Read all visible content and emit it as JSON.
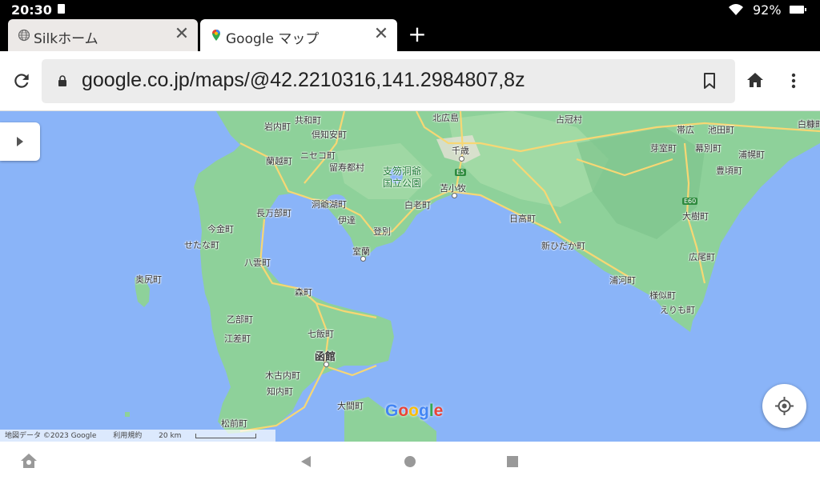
{
  "status": {
    "time": "20:30",
    "battery": "92%"
  },
  "tabs": [
    {
      "label": "Silkホーム",
      "close": "✕"
    },
    {
      "label": "Google マップ",
      "close": "✕"
    }
  ],
  "new_tab": "+",
  "address_bar": {
    "url": "google.co.jp/maps/@42.2210316,141.2984807,8z"
  },
  "map": {
    "labels": [
      {
        "text": "岩内町"
      },
      {
        "text": "共和町"
      },
      {
        "text": "倶知安町"
      },
      {
        "text": "蘭越町"
      },
      {
        "text": "ニセコ町"
      },
      {
        "text": "留寿都村"
      },
      {
        "text": "北広島"
      },
      {
        "text": "千歳"
      },
      {
        "text": "占冠村"
      },
      {
        "text": "帯広"
      },
      {
        "text": "池田町"
      },
      {
        "text": "芽室町"
      },
      {
        "text": "幕別町"
      },
      {
        "text": "浦幌町"
      },
      {
        "text": "豊頃町"
      },
      {
        "text": "白糠町"
      },
      {
        "text": "苫小牧"
      },
      {
        "text": "洞爺湖町"
      },
      {
        "text": "長万部町"
      },
      {
        "text": "伊達"
      },
      {
        "text": "白老町"
      },
      {
        "text": "日高町"
      },
      {
        "text": "大樹町"
      },
      {
        "text": "今金町"
      },
      {
        "text": "せたな町"
      },
      {
        "text": "登別"
      },
      {
        "text": "室蘭"
      },
      {
        "text": "新ひだか町"
      },
      {
        "text": "八雲町"
      },
      {
        "text": "広尾町"
      },
      {
        "text": "奥尻町"
      },
      {
        "text": "森町"
      },
      {
        "text": "浦河町"
      },
      {
        "text": "様似町"
      },
      {
        "text": "えりも町"
      },
      {
        "text": "乙部町"
      },
      {
        "text": "七飯町"
      },
      {
        "text": "江差町"
      },
      {
        "text": "函館"
      },
      {
        "text": "木古内町"
      },
      {
        "text": "知内町"
      },
      {
        "text": "大間町"
      },
      {
        "text": "松前町"
      }
    ],
    "park": {
      "line1": "支笏洞爺",
      "line2": "国立公園"
    },
    "shields": [
      "E5",
      "E60"
    ],
    "google_logo": "Google",
    "logo_colors": [
      "#4285f4",
      "#ea4335",
      "#fbbc05",
      "#4285f4",
      "#34a853",
      "#ea4335"
    ],
    "attribution": {
      "data": "地図データ ©2023 Google",
      "terms": "利用規約",
      "scale": "20 km"
    },
    "colors": {
      "water": "#8ab4f8",
      "land": "#8ed19a",
      "land_light": "#b7e2b8",
      "road": "#f7d774"
    }
  }
}
